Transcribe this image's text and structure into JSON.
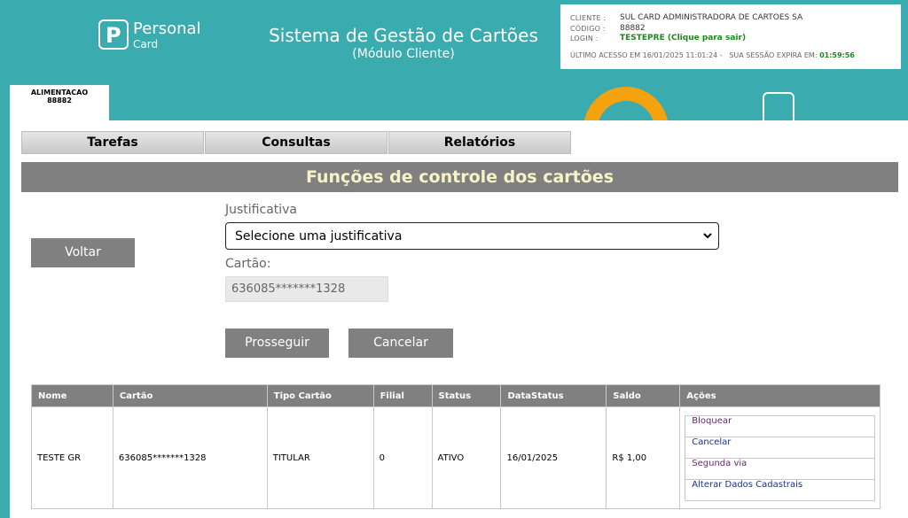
{
  "header": {
    "logo_word1": "Personal",
    "logo_word2": "Card",
    "system_title": "Sistema de Gestão de Cartões",
    "system_subtitle": "(Módulo Cliente)"
  },
  "session": {
    "cliente_label": "CLIENTE :",
    "cliente_value": "SUL CARD ADMINISTRADORA DE CARTOES SA",
    "codigo_label": "CÓDIGO :",
    "codigo_value": "88882",
    "login_label": "LOGIN :",
    "login_value": "TESTEPRE (Clique para sair)",
    "ultimo_acesso": "ÚLTIMO ACESSO EM 16/01/2025 11:01:24 -",
    "sessao_label": "SUA SESSÃO EXPIRA EM:",
    "sessao_timer": "01:59:56"
  },
  "card_tab": {
    "line1": "ALIMENTACAO",
    "line2": "88882"
  },
  "menu": {
    "tarefas": "Tarefas",
    "consultas": "Consultas",
    "relatorios": "Relatórios"
  },
  "page": {
    "title": "Funções de controle dos cartões"
  },
  "form": {
    "voltar": "Voltar",
    "justificativa_label": "Justificativa",
    "justificativa_value": "Selecione uma justificativa",
    "cartao_label": "Cartão:",
    "cartao_value": "636085*******1328",
    "prosseguir": "Prosseguir",
    "cancelar": "Cancelar"
  },
  "table": {
    "headers": [
      "Nome",
      "Cartão",
      "Tipo Cartão",
      "Filial",
      "Status",
      "DataStatus",
      "Saldo",
      "Ações"
    ],
    "row": {
      "nome": "TESTE GR",
      "cartao": "636085*******1328",
      "tipo": "TITULAR",
      "filial": "0",
      "status": "ATIVO",
      "data": "16/01/2025",
      "saldo": "R$ 1,00"
    },
    "actions": [
      "Bloquear",
      "Cancelar",
      "Segunda via",
      "Alterar Dados Cadastrais"
    ]
  },
  "colors": {
    "teal": "#3aabae",
    "orange": "#f5a20f",
    "gray": "#808080",
    "title_text": "#f7f3c8",
    "green": "#1b8a1b"
  }
}
